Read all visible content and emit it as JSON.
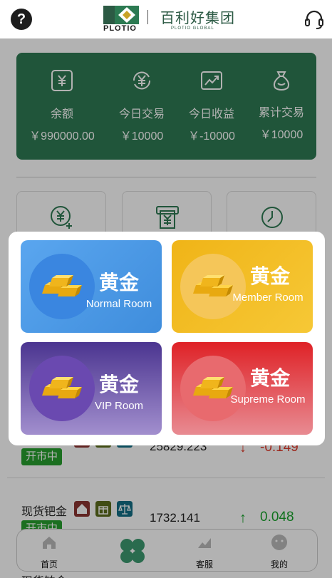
{
  "header": {
    "help_label": "?",
    "brand_word": "PLOTIO",
    "brand_cn": "百利好集团",
    "brand_en": "PLOTIO GLOBAL"
  },
  "stats": [
    {
      "icon": "yuan-box-icon",
      "label": "余额",
      "value": "￥990000.00"
    },
    {
      "icon": "yuan-cycle-icon",
      "label": "今日交易",
      "value": "￥10000"
    },
    {
      "icon": "trend-up-icon",
      "label": "今日收益",
      "value": "￥-10000"
    },
    {
      "icon": "money-bag-icon",
      "label": "累计交易",
      "value": "￥10000"
    }
  ],
  "actions": [
    {
      "icon": "yuan-add-icon"
    },
    {
      "icon": "withdraw-icon"
    },
    {
      "icon": "history-icon"
    }
  ],
  "markets": [
    {
      "name": "",
      "status": "开市中",
      "price": "25829.223",
      "direction": "down",
      "change": "-0.149"
    },
    {
      "name": "现货钯金",
      "status": "开市中",
      "price": "1732.141",
      "direction": "up",
      "change": "0.048"
    },
    {
      "name": "现货铂金",
      "status": "",
      "price": "",
      "direction": "",
      "change": ""
    }
  ],
  "rooms": [
    {
      "title": "黄金",
      "subtitle": "Normal Room",
      "color": "#4a9ae8"
    },
    {
      "title": "黄金",
      "subtitle": "Member Room",
      "color": "#f2b61f"
    },
    {
      "title": "黄金",
      "subtitle": "VIP Room",
      "color": "#5d3f9e"
    },
    {
      "title": "黄金",
      "subtitle": "Supreme Room",
      "color": "#e3363b"
    }
  ],
  "nav": [
    {
      "label": "首页",
      "icon": "home-icon"
    },
    {
      "label": "",
      "icon": "clover-icon"
    },
    {
      "label": "客服",
      "icon": "chart-icon"
    },
    {
      "label": "我的",
      "icon": "user-icon"
    }
  ],
  "colors": {
    "brand_green": "#2f7a53",
    "status_green": "#27a02e",
    "up_green": "#16a32a",
    "down_red": "#e03a2a"
  }
}
